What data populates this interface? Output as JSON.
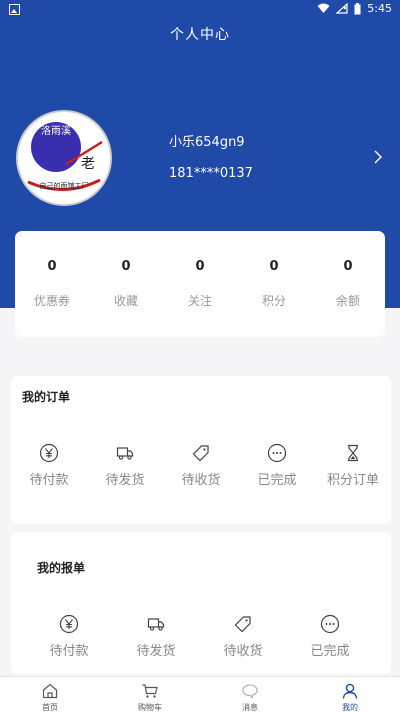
{
  "status_bar": {
    "time": "5:45"
  },
  "page_title": "个人中心",
  "profile": {
    "username": "小乐654gn9",
    "phone": "181****0137",
    "avatar_text": {
      "top": "洛雨溪",
      "side": "老",
      "bottom": "自己的面馆工厂"
    }
  },
  "stats": [
    {
      "value": "0",
      "label": "优惠券"
    },
    {
      "value": "0",
      "label": "收藏"
    },
    {
      "value": "0",
      "label": "关注"
    },
    {
      "value": "0",
      "label": "积分"
    },
    {
      "value": "0",
      "label": "余额"
    }
  ],
  "orders": {
    "title": "我的订单",
    "items": [
      {
        "label": "待付款",
        "icon": "yen-icon"
      },
      {
        "label": "待发货",
        "icon": "truck-icon"
      },
      {
        "label": "待收货",
        "icon": "tag-icon"
      },
      {
        "label": "已完成",
        "icon": "more-icon"
      },
      {
        "label": "积分订单",
        "icon": "hourglass-icon"
      }
    ]
  },
  "reports": {
    "title": "我的报单",
    "items": [
      {
        "label": "待付款",
        "icon": "yen-icon"
      },
      {
        "label": "待发货",
        "icon": "truck-icon"
      },
      {
        "label": "待收货",
        "icon": "tag-icon"
      },
      {
        "label": "已完成",
        "icon": "more-icon"
      }
    ]
  },
  "tabbar": [
    {
      "label": "首页",
      "icon": "home-icon"
    },
    {
      "label": "购物车",
      "icon": "cart-icon"
    },
    {
      "label": "消息",
      "icon": "message-icon"
    },
    {
      "label": "我的",
      "icon": "user-icon",
      "active": true
    }
  ],
  "colors": {
    "primary": "#1f4aa8",
    "background": "#f5f5f7",
    "muted_text": "#999999"
  }
}
